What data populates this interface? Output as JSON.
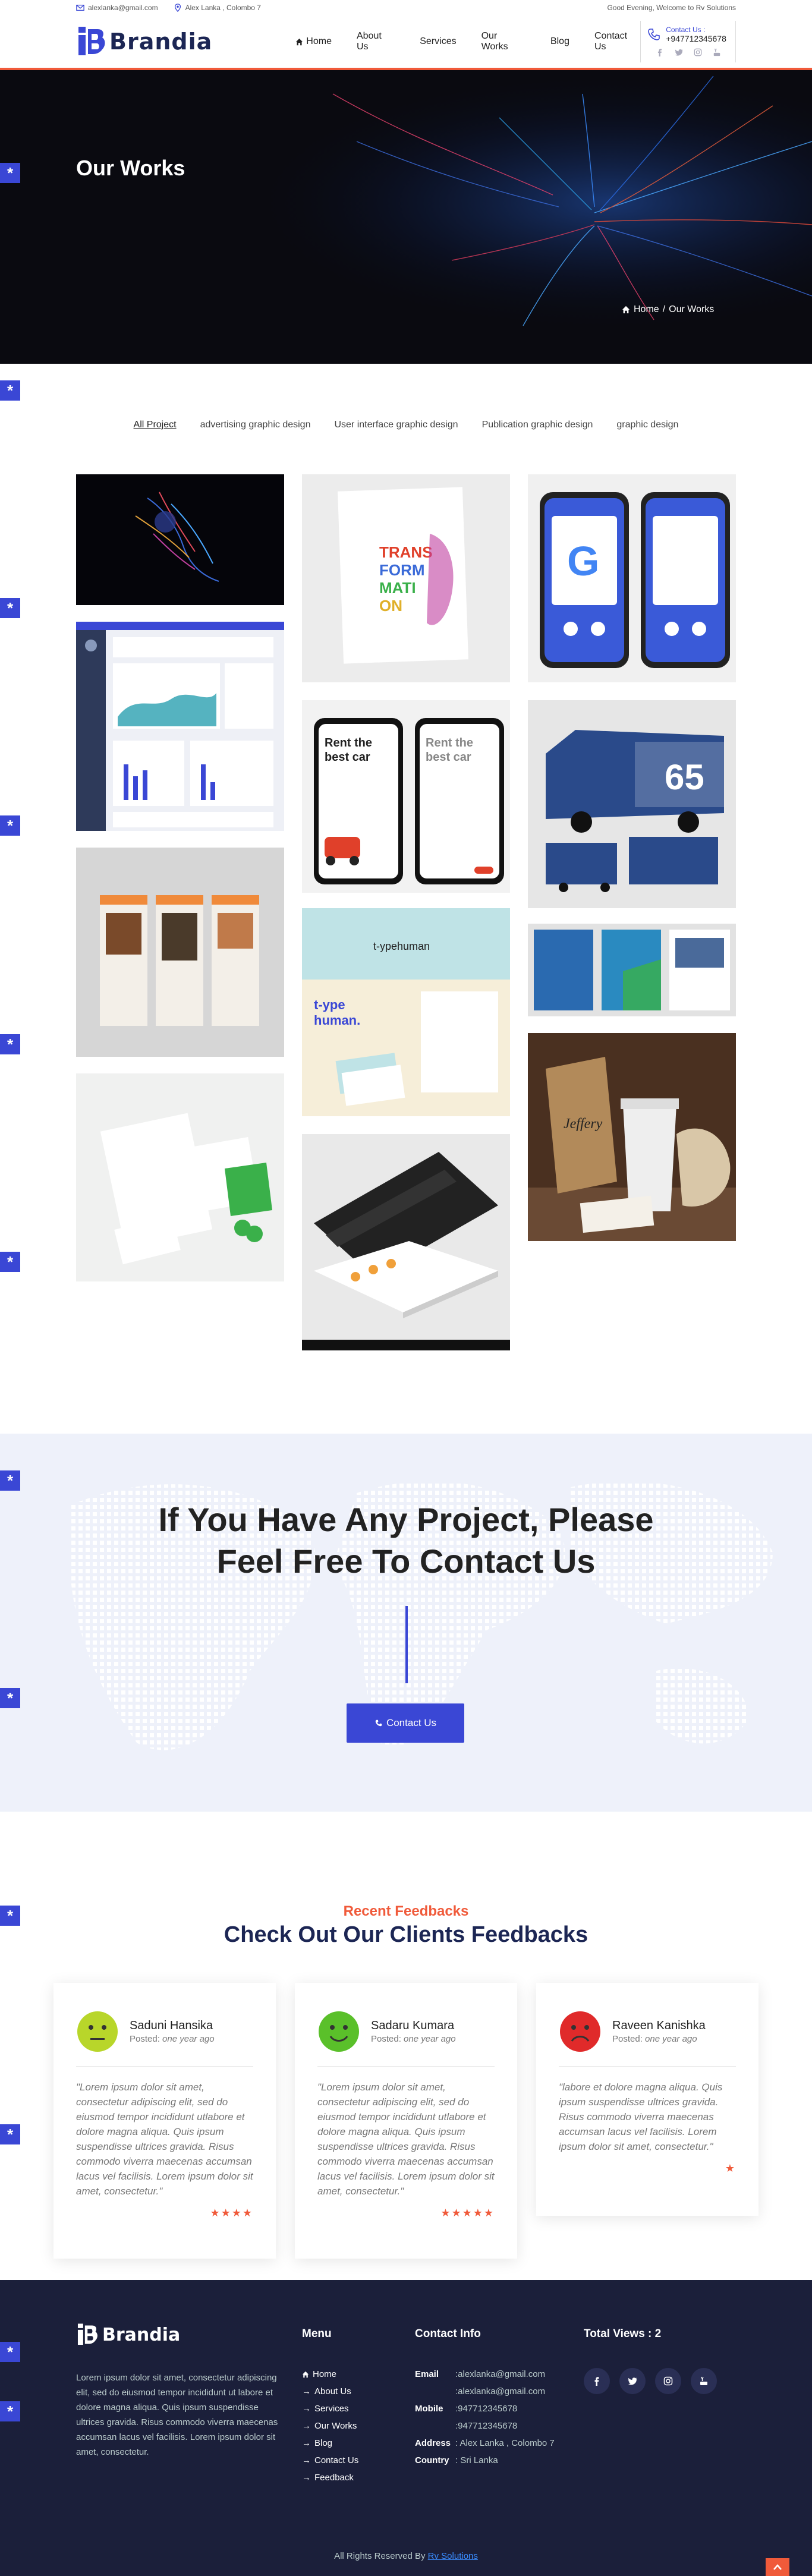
{
  "topbar": {
    "email": "alexlanka@gmail.com",
    "address": "Alex Lanka , Colombo 7",
    "greeting": "Good Evening, Welcome to Rv Solutions"
  },
  "header": {
    "logo_text": "Brandia",
    "nav": [
      "Home",
      "About Us",
      "Services",
      "Our Works",
      "Blog",
      "Contact Us"
    ],
    "contact_label": "Contact Us :",
    "contact_phone": "+947712345678",
    "socials": [
      "facebook-icon",
      "twitter-icon",
      "instagram-icon",
      "youtube-icon"
    ]
  },
  "hero": {
    "title": "Our Works",
    "breadcrumb_home": "Home",
    "breadcrumb_sep": "/",
    "breadcrumb_current": "Our Works"
  },
  "filters": [
    "All Project",
    "advertising graphic design",
    "User interface graphic design",
    "Publication graphic design",
    "graphic design"
  ],
  "cta": {
    "heading_line1": "If You Have Any Project, Please",
    "heading_line2": "Feel Free To Contact Us",
    "button": "Contact Us"
  },
  "feedbacks": {
    "subtitle": "Recent Feedbacks",
    "title": "Check Out Our Clients Feedbacks",
    "items": [
      {
        "name": "Saduni Hansika",
        "posted_prefix": "Posted:",
        "posted": "one year ago",
        "mood": "neutral",
        "text": "\"Lorem ipsum dolor sit amet, consectetur adipiscing elit, sed do eiusmod tempor incididunt utlabore et dolore magna aliqua. Quis ipsum suspendisse ultrices gravida. Risus commodo viverra maecenas accumsan lacus vel facilisis. Lorem ipsum dolor sit amet, consectetur.\"",
        "stars": "★★★★",
        "rating": 4
      },
      {
        "name": "Sadaru Kumara",
        "posted_prefix": "Posted:",
        "posted": "one year ago",
        "mood": "happy",
        "text": "\"Lorem ipsum dolor sit amet, consectetur adipiscing elit, sed do eiusmod tempor incididunt utlabore et dolore magna aliqua. Quis ipsum suspendisse ultrices gravida. Risus commodo viverra maecenas accumsan lacus vel facilisis. Lorem ipsum dolor sit amet, consectetur.\"",
        "stars": "★★★★★",
        "rating": 5
      },
      {
        "name": "Raveen Kanishka",
        "posted_prefix": "Posted:",
        "posted": "one year ago",
        "mood": "sad",
        "text": "\"labore et dolore magna aliqua. Quis ipsum suspendisse ultrices gravida. Risus commodo viverra maecenas accumsan lacus vel facilisis. Lorem ipsum dolor sit amet, consectetur.\"",
        "stars": "★",
        "rating": 1
      }
    ]
  },
  "footer": {
    "logo_text": "Brandia",
    "about": "Lorem ipsum dolor sit amet, consectetur adipiscing elit, sed do eiusmod tempor incididunt ut labore et dolore magna aliqua. Quis ipsum suspendisse ultrices gravida. Risus commodo viverra maecenas accumsan lacus vel facilisis. Lorem ipsum dolor sit amet, consectetur.",
    "menu_title": "Menu",
    "menu": [
      "Home",
      "About Us",
      "Services",
      "Our Works",
      "Blog",
      "Contact Us",
      "Feedback"
    ],
    "contact_title": "Contact Info",
    "email_label": "Email",
    "emails": [
      ":alexlanka@gmail.com",
      ":alexlanka@gmail.com"
    ],
    "mobile_label": "Mobile",
    "mobiles": [
      ":947712345678",
      ":947712345678"
    ],
    "address_label": "Address",
    "address": ": Alex Lanka , Colombo 7",
    "country_label": "Country",
    "country": ": Sri Lanka",
    "views": "Total Views : 2",
    "copyright": "All Rights Reserved By",
    "copyright_link": "Rv Solutions"
  },
  "colors": {
    "accent": "#3a47d5",
    "brand_orange": "#f05a3a",
    "navy": "#1c2654",
    "footer_bg": "#1b1f3a"
  }
}
